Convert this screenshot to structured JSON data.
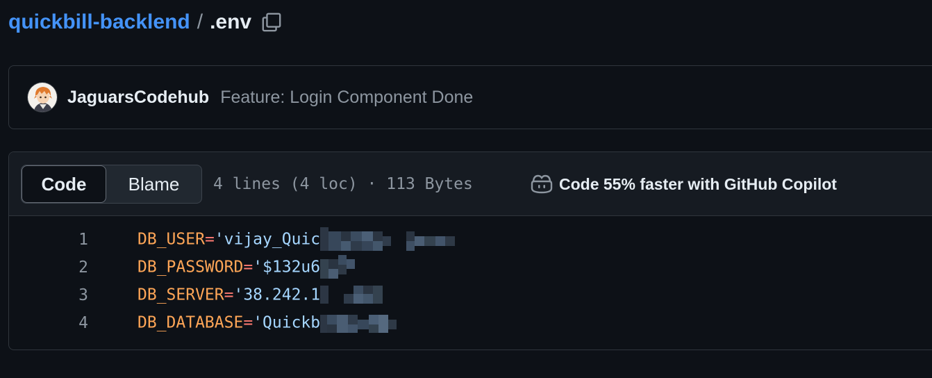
{
  "breadcrumb": {
    "repo": "quickbill-backlend",
    "separator": "/",
    "file": ".env",
    "copy_icon": "copy-icon"
  },
  "commit": {
    "author": "JaguarsCodehub",
    "message": "Feature: Login Component Done",
    "avatar_icon": "user-avatar"
  },
  "file_header": {
    "tabs": [
      {
        "label": "Code",
        "selected": true
      },
      {
        "label": "Blame",
        "selected": false
      }
    ],
    "info": "4 lines (4 loc) · 113 Bytes",
    "copilot_icon": "copilot-icon",
    "copilot_text": "Code 55% faster with GitHub Copilot"
  },
  "code": {
    "lines": [
      {
        "number": "1",
        "key": "DB_USER",
        "eq": "=",
        "value": "'vijay_Quic"
      },
      {
        "number": "2",
        "key": "DB_PASSWORD",
        "eq": "=",
        "value": "'$132u6"
      },
      {
        "number": "3",
        "key": "DB_SERVER",
        "eq": "=",
        "value": "'38.242.1"
      },
      {
        "number": "4",
        "key": "DB_DATABASE",
        "eq": "=",
        "value": "'Quickb"
      }
    ]
  },
  "colors": {
    "background": "#0d1117",
    "link": "#4493f8",
    "border": "#30363d",
    "key": "#ffa657",
    "operator": "#ff7b72",
    "string": "#a5d6ff",
    "muted": "#8d96a0"
  }
}
